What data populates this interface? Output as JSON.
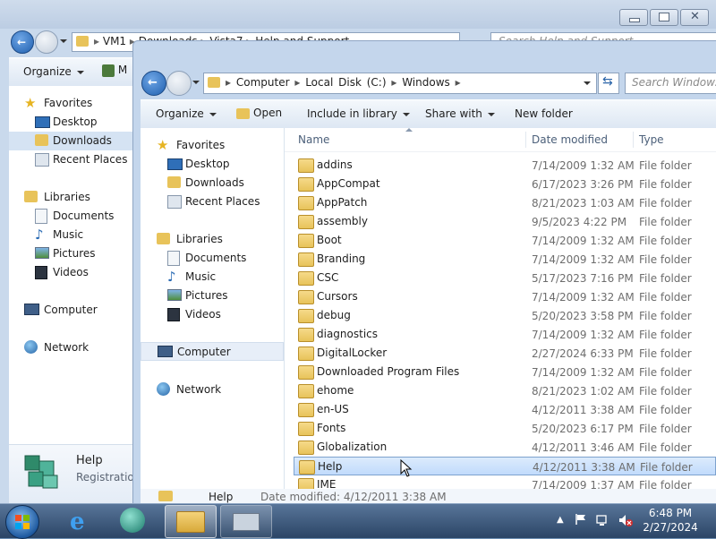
{
  "back_window": {
    "address": [
      "VM1",
      "Downloads",
      "Vista7",
      "Help and Support"
    ],
    "search_placeholder": "Search Help and Support",
    "toolbar": {
      "organize": "Organize",
      "more": "M"
    },
    "nav": {
      "favorites": "Favorites",
      "favorites_items": [
        "Desktop",
        "Downloads",
        "Recent Places"
      ],
      "libraries": "Libraries",
      "libraries_items": [
        "Documents",
        "Music",
        "Pictures",
        "Videos"
      ],
      "computer": "Computer",
      "network": "Network"
    },
    "details": {
      "name": "Help",
      "type": "Registration"
    }
  },
  "front_window": {
    "address": [
      "Computer",
      "Local Disk (C:)",
      "Windows"
    ],
    "search_placeholder": "Search Windows",
    "toolbar": {
      "organize": "Organize",
      "open": "Open",
      "include_in_library": "Include in library",
      "share_with": "Share with",
      "new_folder": "New folder"
    },
    "nav": {
      "favorites": "Favorites",
      "favorites_items": [
        "Desktop",
        "Downloads",
        "Recent Places"
      ],
      "libraries": "Libraries",
      "libraries_items": [
        "Documents",
        "Music",
        "Pictures",
        "Videos"
      ],
      "computer": "Computer",
      "network": "Network"
    },
    "columns": {
      "name": "Name",
      "date_modified": "Date modified",
      "type": "Type"
    },
    "files": [
      {
        "name": "addins",
        "date": "7/14/2009 1:32 AM",
        "type": "File folder"
      },
      {
        "name": "AppCompat",
        "date": "6/17/2023 3:26 PM",
        "type": "File folder"
      },
      {
        "name": "AppPatch",
        "date": "8/21/2023 1:03 AM",
        "type": "File folder"
      },
      {
        "name": "assembly",
        "date": "9/5/2023 4:22 PM",
        "type": "File folder"
      },
      {
        "name": "Boot",
        "date": "7/14/2009 1:32 AM",
        "type": "File folder"
      },
      {
        "name": "Branding",
        "date": "7/14/2009 1:32 AM",
        "type": "File folder"
      },
      {
        "name": "CSC",
        "date": "5/17/2023 7:16 PM",
        "type": "File folder"
      },
      {
        "name": "Cursors",
        "date": "7/14/2009 1:32 AM",
        "type": "File folder"
      },
      {
        "name": "debug",
        "date": "5/20/2023 3:58 PM",
        "type": "File folder"
      },
      {
        "name": "diagnostics",
        "date": "7/14/2009 1:32 AM",
        "type": "File folder"
      },
      {
        "name": "DigitalLocker",
        "date": "2/27/2024 6:33 PM",
        "type": "File folder"
      },
      {
        "name": "Downloaded Program Files",
        "date": "7/14/2009 1:32 AM",
        "type": "File folder"
      },
      {
        "name": "ehome",
        "date": "8/21/2023 1:02 AM",
        "type": "File folder"
      },
      {
        "name": "en-US",
        "date": "4/12/2011 3:38 AM",
        "type": "File folder"
      },
      {
        "name": "Fonts",
        "date": "5/20/2023 6:17 PM",
        "type": "File folder"
      },
      {
        "name": "Globalization",
        "date": "4/12/2011 3:46 AM",
        "type": "File folder"
      },
      {
        "name": "Help",
        "date": "4/12/2011 3:38 AM",
        "type": "File folder"
      },
      {
        "name": "IME",
        "date": "7/14/2009 1:37 AM",
        "type": "File folder"
      }
    ],
    "status_peek": {
      "name": "Help",
      "date_label": "Date modified: 4/12/2011 3:38 AM"
    }
  },
  "taskbar": {
    "time": "6:48 PM",
    "date": "2/27/2024"
  },
  "colors": {
    "taskbar": "#2b4566",
    "selection": "#c1dbfc",
    "folder": "#e8c35a"
  }
}
